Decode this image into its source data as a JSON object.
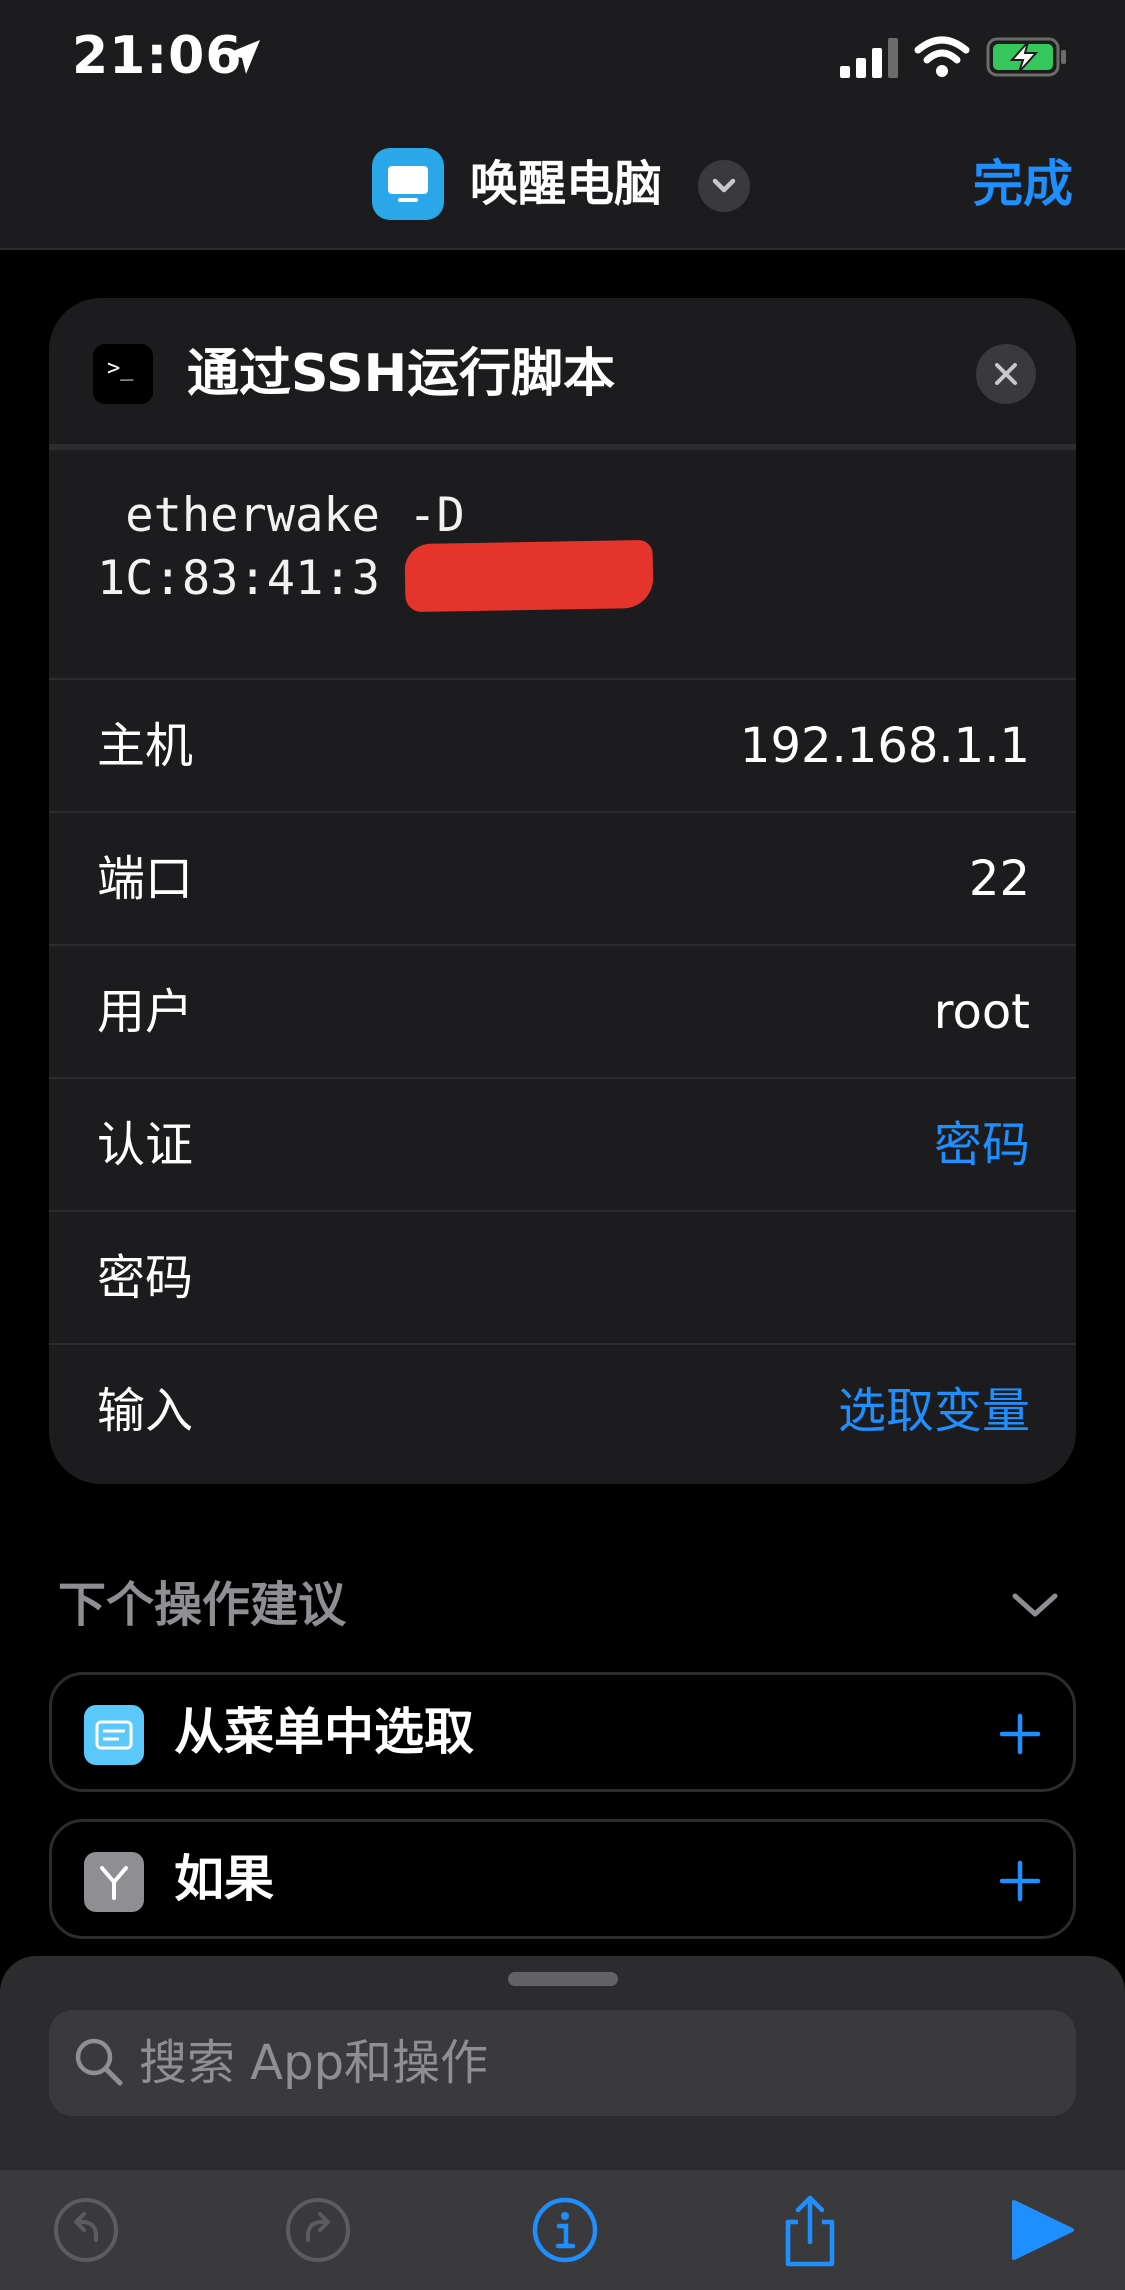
{
  "status_bar": {
    "time": "21:06"
  },
  "nav": {
    "shortcut_title": "唤醒电脑",
    "done_label": "完成"
  },
  "action": {
    "title": "通过SSH运行脚本",
    "script_line1": " etherwake -D",
    "script_line2": "1C:83:41:3      A",
    "params": [
      {
        "label": "主机",
        "value": "192.168.1.1"
      },
      {
        "label": "端口",
        "value": "22"
      },
      {
        "label": "用户",
        "value": "root"
      },
      {
        "label": "认证",
        "value": "密码"
      },
      {
        "label": "密码",
        "value": ""
      },
      {
        "label": "输入",
        "value": "选取变量"
      }
    ]
  },
  "suggestions": {
    "header": "下个操作建议",
    "items": [
      {
        "label": "从菜单中选取",
        "icon": "menu-icon",
        "color": "#5ac8fa"
      },
      {
        "label": "如果",
        "icon": "branch-icon",
        "color": "#8e8e93"
      }
    ]
  },
  "search": {
    "placeholder": "搜索 App和操作"
  },
  "colors": {
    "accent": "#1f8fff",
    "battery": "#34c759",
    "redaction": "#e5342b"
  }
}
